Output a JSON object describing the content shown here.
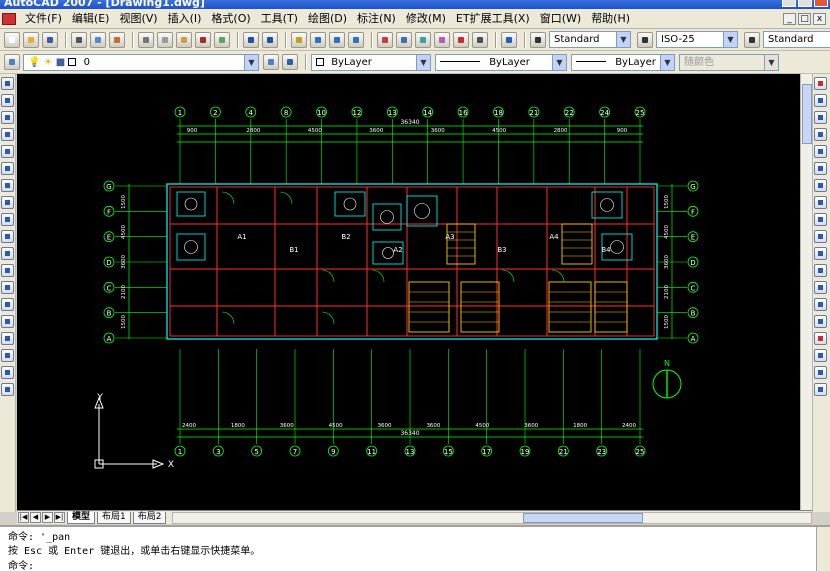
{
  "window": {
    "title": "AutoCAD 2007 - [Drawing1.dwg]"
  },
  "menu": {
    "items": [
      "文件(F)",
      "编辑(E)",
      "视图(V)",
      "插入(I)",
      "格式(O)",
      "工具(T)",
      "绘图(D)",
      "标注(N)",
      "修改(M)",
      "ET扩展工具(X)",
      "窗口(W)",
      "帮助(H)"
    ]
  },
  "styles_toolbar": {
    "text_style": "Standard",
    "dim_style": "ISO-25",
    "table_style": "Standard"
  },
  "layers_toolbar": {
    "layer_name": "0",
    "color": "ByLayer",
    "linetype": "ByLayer",
    "lineweight": "ByLayer",
    "plot_style": "随颜色"
  },
  "drawing": {
    "grid_top": [
      "1",
      "2",
      "4",
      "8",
      "10",
      "12",
      "13",
      "14",
      "16",
      "18",
      "21",
      "22",
      "24",
      "25"
    ],
    "grid_left": [
      "G",
      "F",
      "E",
      "D",
      "C",
      "B",
      "A"
    ],
    "grid_right": [
      "G",
      "F",
      "E",
      "D",
      "C",
      "B",
      "A"
    ],
    "grid_bottom": [
      "1",
      "3",
      "5",
      "7",
      "9",
      "11",
      "13",
      "15",
      "17",
      "19",
      "21",
      "23",
      "25"
    ],
    "overall_dimension": "36340",
    "top_dims": [
      "900",
      "2800",
      "4500",
      "3600",
      "3600",
      "4500",
      "2800",
      "900"
    ],
    "bottom_dims": [
      "2400",
      "1800",
      "3600",
      "4500",
      "3600",
      "3600",
      "4500",
      "3600",
      "1800",
      "2400"
    ],
    "side_dims": [
      "1500",
      "4500",
      "3600",
      "2100",
      "1500"
    ],
    "room_labels": [
      "A1",
      "B1",
      "B2",
      "A2",
      "A3",
      "B3",
      "A4",
      "B4"
    ],
    "north_label": "N",
    "ucs_x": "X",
    "ucs_y": "Y",
    "colors": {
      "grid": "#00ff00",
      "walls": "#ff3030",
      "detail": "#00ffff",
      "furniture": "#ffcc00",
      "text": "#ffffff"
    }
  },
  "tabs": {
    "items": [
      "模型",
      "布局1",
      "布局2"
    ],
    "active": 0
  },
  "command": {
    "line1": "命令: '_pan",
    "line2": "按 Esc 或 Enter 键退出，或单击右键显示快捷菜单。",
    "prompt": "命令:"
  }
}
